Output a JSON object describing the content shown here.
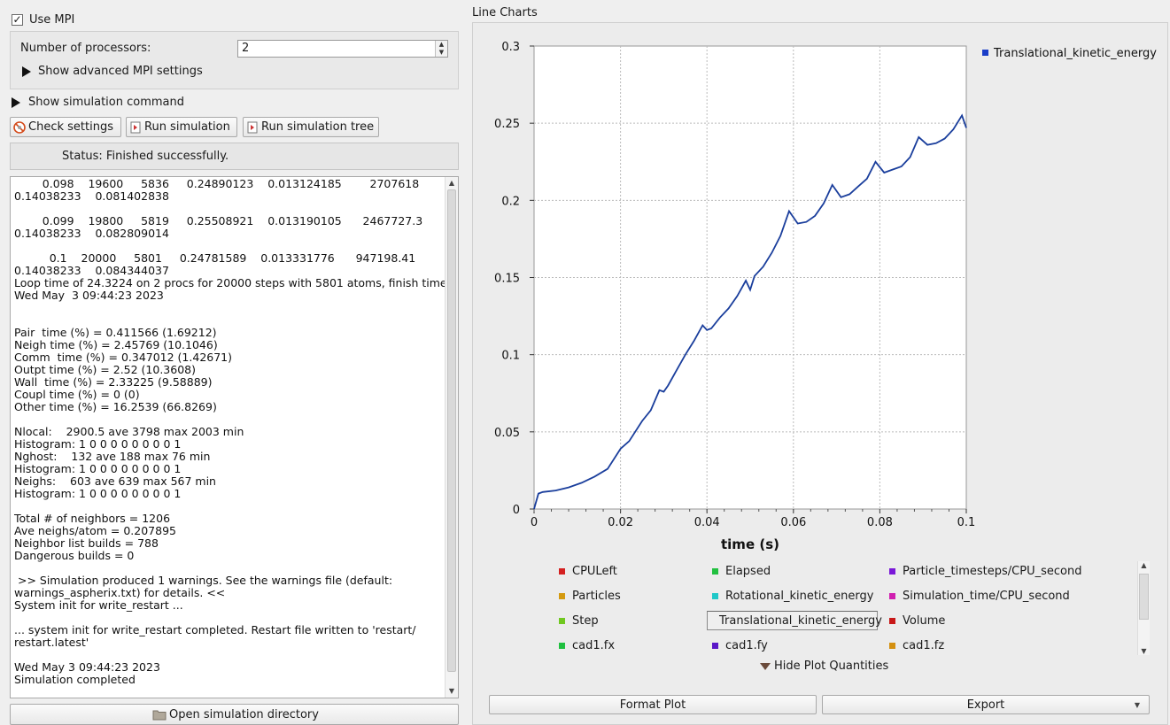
{
  "mpi": {
    "use_mpi_label": "Use MPI",
    "use_mpi_checked": "✓",
    "num_processors_label": "Number of processors:",
    "num_processors_value": "2",
    "advanced_label": "Show advanced MPI settings"
  },
  "sim": {
    "show_command_label": "Show simulation command",
    "check_settings": "Check settings",
    "run_simulation": "Run simulation",
    "run_tree": "Run simulation tree",
    "status": "Status: Finished successfully.",
    "open_dir": "Open simulation directory"
  },
  "log_lines": [
    "        0.098    19600     5836     0.24890123    0.013124185        2707618",
    "0.14038233    0.081402838",
    "",
    "        0.099    19800     5819     0.25508921    0.013190105      2467727.3",
    "0.14038233    0.082809014",
    "",
    "          0.1    20000     5801     0.24781589    0.013331776      947198.41",
    "0.14038233    0.084344037",
    "Loop time of 24.3224 on 2 procs for 20000 steps with 5801 atoms, finish time",
    "Wed May  3 09:44:23 2023",
    "",
    "",
    "Pair  time (%) = 0.411566 (1.69212)",
    "Neigh time (%) = 2.45769 (10.1046)",
    "Comm  time (%) = 0.347012 (1.42671)",
    "Outpt time (%) = 2.52 (10.3608)",
    "Wall  time (%) = 2.33225 (9.58889)",
    "Coupl time (%) = 0 (0)",
    "Other time (%) = 16.2539 (66.8269)",
    "",
    "Nlocal:    2900.5 ave 3798 max 2003 min",
    "Histogram: 1 0 0 0 0 0 0 0 0 1",
    "Nghost:    132 ave 188 max 76 min",
    "Histogram: 1 0 0 0 0 0 0 0 0 1",
    "Neighs:    603 ave 639 max 567 min",
    "Histogram: 1 0 0 0 0 0 0 0 0 1",
    "",
    "Total # of neighbors = 1206",
    "Ave neighs/atom = 0.207895",
    "Neighbor list builds = 788",
    "Dangerous builds = 0",
    "",
    " >> Simulation produced 1 warnings. See the warnings file (default:",
    "warnings_aspherix.txt) for details. <<",
    "System init for write_restart ...",
    "",
    "... system init for write_restart completed. Restart file written to 'restart/",
    "restart.latest'",
    "",
    "Wed May 3 09:44:23 2023",
    "Simulation completed"
  ],
  "chart_panel": {
    "title": "Line Charts",
    "hide_quantities": "Hide Plot Quantities",
    "format_plot": "Format Plot",
    "export": "Export"
  },
  "quantities": [
    {
      "label": "CPULeft",
      "color": "#d42020"
    },
    {
      "label": "Elapsed",
      "color": "#22c040"
    },
    {
      "label": "Particle_timesteps/CPU_second",
      "color": "#7a18d8"
    },
    {
      "label": "Particles",
      "color": "#d49a10"
    },
    {
      "label": "Rotational_kinetic_energy",
      "color": "#20c8c8"
    },
    {
      "label": "Simulation_time/CPU_second",
      "color": "#d020b0"
    },
    {
      "label": "Step",
      "color": "#70c820"
    },
    {
      "label": "Translational_kinetic_energy",
      "color": "#1a3ec8",
      "selected": true
    },
    {
      "label": "Volume",
      "color": "#c81818"
    },
    {
      "label": "cad1.fx",
      "color": "#20c040"
    },
    {
      "label": "cad1.fy",
      "color": "#5a18c8"
    },
    {
      "label": "cad1.fz",
      "color": "#d49010"
    }
  ],
  "chart_data": {
    "type": "line",
    "title": "",
    "xlabel": "time (s)",
    "ylabel": "",
    "xlim": [
      0,
      0.1
    ],
    "ylim": [
      0,
      0.3
    ],
    "xticks": [
      "0",
      "0.02",
      "0.04",
      "0.06",
      "0.08",
      "0.1"
    ],
    "yticks": [
      "0",
      "0.05",
      "0.1",
      "0.15",
      "0.2",
      "0.25",
      "0.3"
    ],
    "grid": true,
    "legend_position": "top-right",
    "series": [
      {
        "name": "Translational_kinetic_energy",
        "color": "#1a3e9c",
        "points": [
          [
            0,
            0
          ],
          [
            0.001,
            0.01
          ],
          [
            0.002,
            0.011
          ],
          [
            0.005,
            0.012
          ],
          [
            0.008,
            0.014
          ],
          [
            0.011,
            0.017
          ],
          [
            0.014,
            0.021
          ],
          [
            0.017,
            0.026
          ],
          [
            0.02,
            0.039
          ],
          [
            0.022,
            0.044
          ],
          [
            0.025,
            0.057
          ],
          [
            0.027,
            0.064
          ],
          [
            0.029,
            0.077
          ],
          [
            0.03,
            0.076
          ],
          [
            0.031,
            0.08
          ],
          [
            0.033,
            0.09
          ],
          [
            0.035,
            0.1
          ],
          [
            0.037,
            0.109
          ],
          [
            0.039,
            0.119
          ],
          [
            0.04,
            0.116
          ],
          [
            0.041,
            0.117
          ],
          [
            0.043,
            0.124
          ],
          [
            0.045,
            0.13
          ],
          [
            0.047,
            0.138
          ],
          [
            0.049,
            0.148
          ],
          [
            0.05,
            0.142
          ],
          [
            0.051,
            0.151
          ],
          [
            0.053,
            0.157
          ],
          [
            0.055,
            0.166
          ],
          [
            0.057,
            0.177
          ],
          [
            0.059,
            0.193
          ],
          [
            0.061,
            0.185
          ],
          [
            0.063,
            0.186
          ],
          [
            0.065,
            0.19
          ],
          [
            0.067,
            0.198
          ],
          [
            0.069,
            0.21
          ],
          [
            0.071,
            0.202
          ],
          [
            0.073,
            0.204
          ],
          [
            0.075,
            0.209
          ],
          [
            0.077,
            0.214
          ],
          [
            0.079,
            0.225
          ],
          [
            0.081,
            0.218
          ],
          [
            0.083,
            0.22
          ],
          [
            0.085,
            0.222
          ],
          [
            0.087,
            0.228
          ],
          [
            0.089,
            0.241
          ],
          [
            0.091,
            0.236
          ],
          [
            0.093,
            0.237
          ],
          [
            0.095,
            0.24
          ],
          [
            0.097,
            0.246
          ],
          [
            0.099,
            0.255
          ],
          [
            0.1,
            0.247
          ]
        ]
      }
    ]
  }
}
